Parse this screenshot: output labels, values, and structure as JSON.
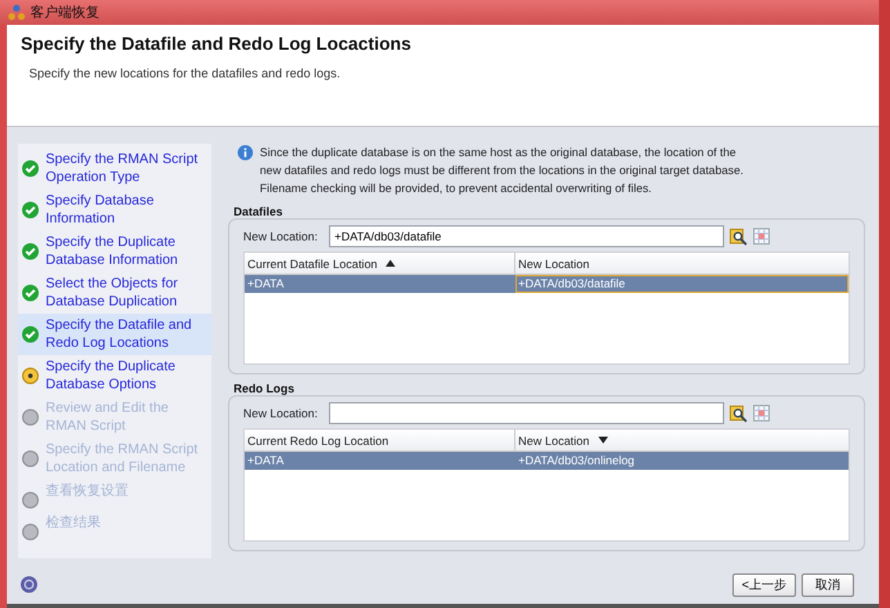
{
  "window": {
    "title": "客户端恢复"
  },
  "header": {
    "title": "Specify the Datafile and Redo Log Locactions",
    "subtitle": "Specify the new locations for the datafiles and redo logs."
  },
  "steps": [
    {
      "label": "Specify the RMAN Script Operation Type",
      "kind": "done",
      "selected": false
    },
    {
      "label": "Specify Database Information",
      "kind": "done",
      "selected": false
    },
    {
      "label": "Specify the Duplicate Database Information",
      "kind": "done",
      "selected": false
    },
    {
      "label": "Select the Objects for Database Duplication",
      "kind": "done",
      "selected": false
    },
    {
      "label": "Specify the Datafile and Redo Log Locations",
      "kind": "done",
      "selected": true
    },
    {
      "label": "Specify the Duplicate Database Options",
      "kind": "current",
      "selected": false
    },
    {
      "label": "Review and Edit the RMAN Script",
      "kind": "pending",
      "selected": false
    },
    {
      "label": "Specify the RMAN Script Location and Filename",
      "kind": "pending",
      "selected": false
    },
    {
      "label": "查看恢复设置",
      "kind": "pending",
      "selected": false
    },
    {
      "label": "检查结果",
      "kind": "pending",
      "selected": false
    }
  ],
  "info": "Since the duplicate database is on the same host as the original database, the location of the new datafiles and redo logs must be different from the locations in the original target database. Filename checking will be provided, to prevent accidental overwriting of files.",
  "sections": [
    {
      "title": "Datafiles",
      "field_label": "New Location:",
      "value": "+DATA/db03/datafile",
      "columns": [
        {
          "label": "Current Datafile Location",
          "kind": "sorted-ascending"
        },
        {
          "label": "New Location",
          "kind": "plain"
        }
      ],
      "rows": [
        {
          "cells": [
            "+DATA",
            "+DATA/db03/datafile"
          ],
          "selected": true
        }
      ]
    },
    {
      "title": "Redo Logs",
      "field_label": "New Location:",
      "columns": [
        {
          "label": "Current Redo Log Location",
          "kind": "plain"
        },
        {
          "label": "New Location",
          "kind": "sorted-descending"
        }
      ],
      "rows": [
        {
          "cells": [
            "+DATA",
            "+DATA/db03/onlinelog"
          ],
          "selected": true
        }
      ]
    }
  ],
  "buttons": [
    "<上一步",
    "取消"
  ]
}
